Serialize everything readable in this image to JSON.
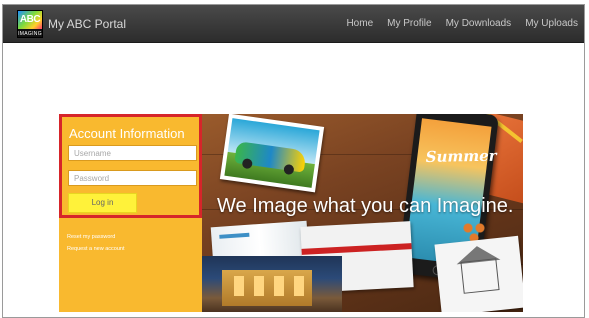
{
  "navbar": {
    "logo_main": "ABC",
    "logo_sub": "IMAGING",
    "portal_title": "My ABC Portal",
    "links": [
      "Home",
      "My Profile",
      "My Downloads",
      "My Uploads"
    ]
  },
  "login": {
    "title": "Account Information",
    "username_placeholder": "Username",
    "password_placeholder": "Password",
    "button_label": "Log in",
    "reset_link": "Reset my password",
    "request_link": "Request a new account"
  },
  "hero": {
    "headline": "We Image what you can Imagine.",
    "tablet_text": "Summer"
  },
  "colors": {
    "navbar": "#333333",
    "panel": "#f9b92f",
    "highlight_border": "#d6252a",
    "login_button": "#fff23a"
  }
}
